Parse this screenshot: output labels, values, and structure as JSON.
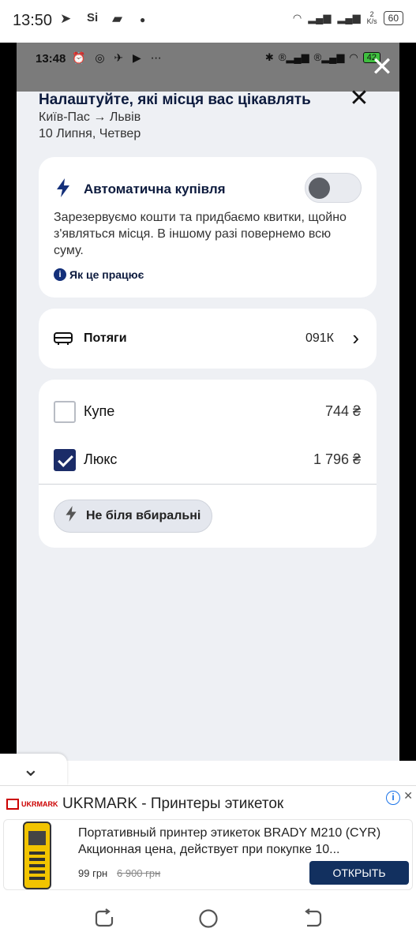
{
  "phone_status": {
    "time": "13:50",
    "net_speed": "2\nK/s",
    "battery": "60"
  },
  "inner_status": {
    "time": "13:48",
    "battery": "42"
  },
  "header": {
    "title": "Налаштуйте, які місця вас цікавлять",
    "route": "Київ-Пас → Львів",
    "date": "10 Липня, Четвер"
  },
  "auto_purchase": {
    "title": "Автоматична купівля",
    "description": "Зарезервуємо кошти та придбаємо квитки, щойно з'являться місця. В іншому разі повернемо всю суму.",
    "how_link": "Як це працює",
    "enabled": false
  },
  "trains": {
    "label": "Потяги",
    "number": "091К"
  },
  "classes": [
    {
      "label": "Купе",
      "price": "744 ₴",
      "checked": false
    },
    {
      "label": "Люкс",
      "price": "1 796 ₴",
      "checked": true
    }
  ],
  "filter_chip": {
    "label": "Не біля вбиральні"
  },
  "ad": {
    "brand": "UKRMARK",
    "title": "UKRMARK - Принтеры этикеток",
    "description": "Портативный принтер этикеток BRADY M210 (CYR) Акционная цена, действует при покупке 10...",
    "price": "99 грн",
    "old_price": "6 900 грн",
    "button": "ОТКРЫТЬ"
  },
  "colors": {
    "navy": "#0d1b3e",
    "accent": "#1b2c68",
    "background": "#eef0f4",
    "ad_button": "#12305f"
  }
}
